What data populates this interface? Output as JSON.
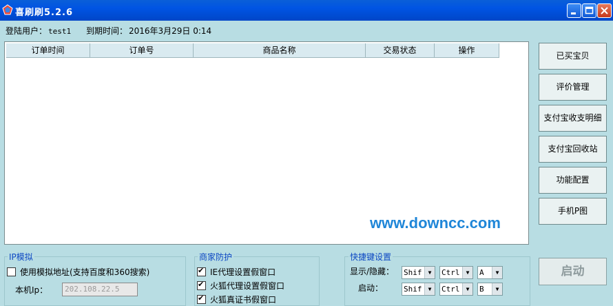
{
  "window": {
    "title": "喜刷刷5.2.6"
  },
  "user": {
    "login_label": "登陆用户：",
    "login_value": "test1",
    "expire_label": "到期时间：",
    "expire_value": "2016年3月29日 0:14"
  },
  "table": {
    "columns": [
      "订单时间",
      "订单号",
      "商品名称",
      "交易状态",
      "操作"
    ]
  },
  "watermark": "www.downcc.com",
  "side_buttons": [
    "已买宝贝",
    "评价管理",
    "支付宝收支明细",
    "支付宝回收站",
    "功能配置",
    "手机P图"
  ],
  "ip_section": {
    "title": "IP模拟",
    "use_sim": "使用模拟地址(支持百度和360搜索)",
    "local_ip_label": "本机Ip：",
    "local_ip_value": "202.108.22.5"
  },
  "merchant_section": {
    "title": "商家防护",
    "items": [
      "IE代理设置假窗口",
      "火狐代理设置假窗口",
      "火狐真证书假窗口"
    ]
  },
  "hotkey_section": {
    "title": "快捷键设置",
    "show_hide_label": "显示/隐藏：",
    "start_label": "启动：",
    "show_hide": [
      "Shif",
      "Ctrl",
      "A"
    ],
    "start": [
      "Shif",
      "Ctrl",
      "B"
    ]
  },
  "start_button": "启动"
}
